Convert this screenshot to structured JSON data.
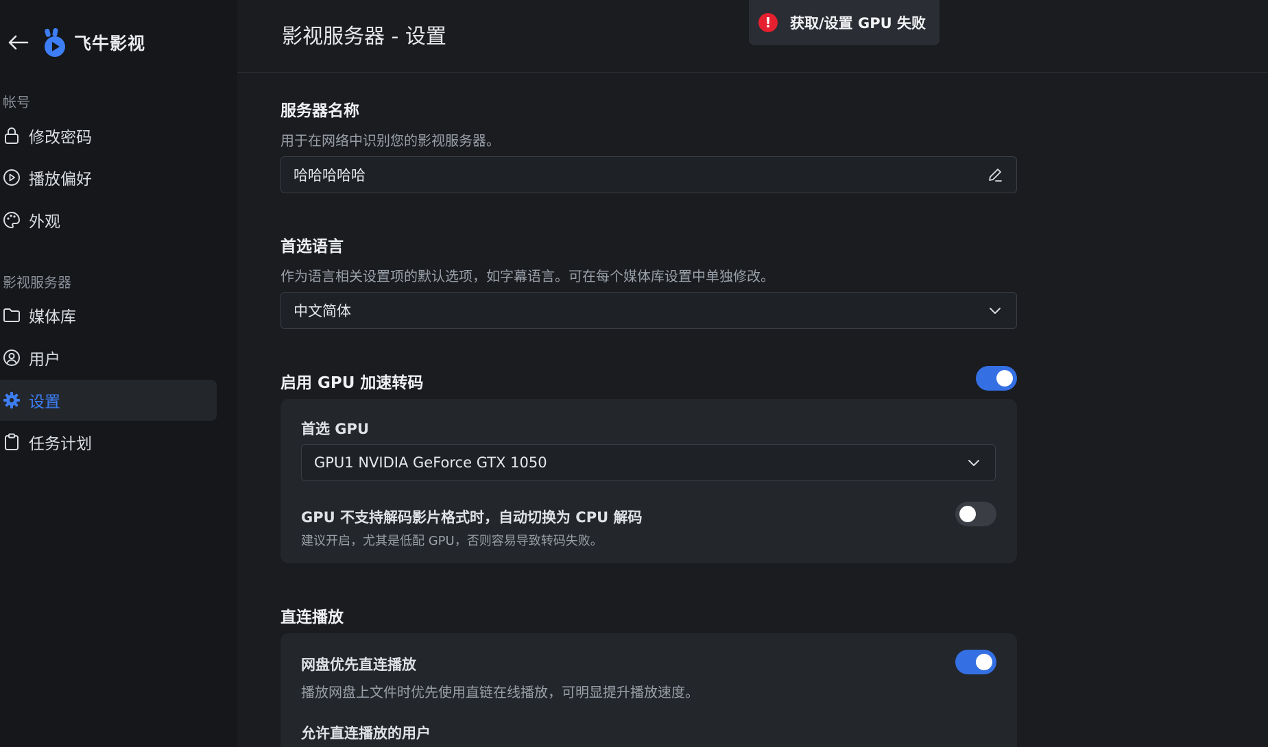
{
  "sidebar": {
    "brand_name": "飞牛影视",
    "account_group": "帐号",
    "account_items": [
      {
        "label": "修改密码",
        "icon": "lock-icon"
      },
      {
        "label": "播放偏好",
        "icon": "play-circle-icon"
      },
      {
        "label": "外观",
        "icon": "palette-icon"
      }
    ],
    "server_group": "影视服务器",
    "server_items": [
      {
        "label": "媒体库",
        "icon": "folder-icon"
      },
      {
        "label": "用户",
        "icon": "user-circle-icon"
      },
      {
        "label": "设置",
        "icon": "gear-icon",
        "active": true
      },
      {
        "label": "任务计划",
        "icon": "clipboard-icon"
      }
    ]
  },
  "header": {
    "title": "影视服务器 - 设置"
  },
  "toast": {
    "message": "获取/设置 GPU 失败",
    "color": "#e5202f"
  },
  "server_name": {
    "title": "服务器名称",
    "description": "用于在网络中识别您的影视服务器。",
    "value": "哈哈哈哈哈"
  },
  "language": {
    "title": "首选语言",
    "description": "作为语言相关设置项的默认选项，如字幕语言。可在每个媒体库设置中单独修改。",
    "selected": "中文简体"
  },
  "gpu": {
    "title": "启用 GPU 加速转码",
    "enabled": true,
    "preferred_label": "首选 GPU",
    "preferred_value": "GPU1 NVIDIA GeForce GTX 1050",
    "fallback_label": "GPU 不支持解码影片格式时，自动切换为 CPU 解码",
    "fallback_desc": "建议开启，尤其是低配 GPU，否则容易导致转码失败。",
    "fallback_enabled": false
  },
  "direct_play": {
    "title": "直连播放",
    "netdisk_label": "网盘优先直连播放",
    "netdisk_desc": "播放网盘上文件时优先使用直链在线播放，可明显提升播放速度。",
    "netdisk_enabled": true,
    "allowed_users_label": "允许直连播放的用户"
  },
  "colors": {
    "accent": "#3d7ef5",
    "toggle_on": "#3470e4"
  }
}
